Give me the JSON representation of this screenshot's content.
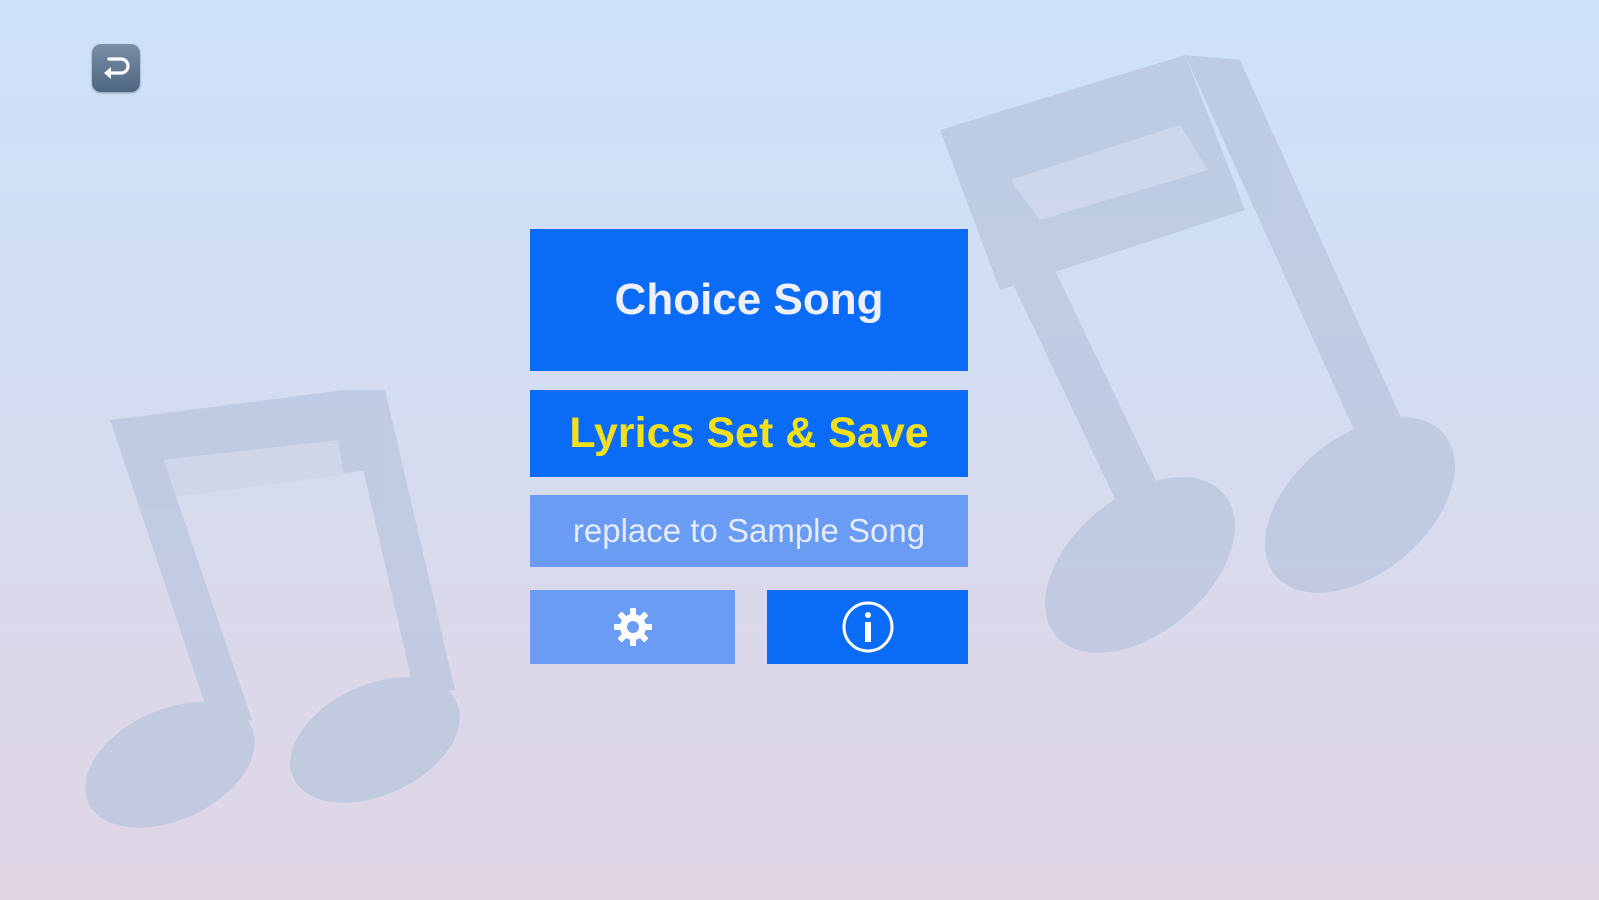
{
  "toolbar": {
    "back_icon": "return-arrow-icon"
  },
  "menu": {
    "choice_song_label": "Choice Song",
    "lyrics_set_save_label": "Lyrics Set & Save",
    "replace_sample_label": "replace to Sample Song",
    "settings_icon": "gear-icon",
    "info_icon": "info-icon"
  },
  "background": {
    "decoration_icon": "music-note-icon"
  },
  "colors": {
    "primary_button": "#0a6cf6",
    "secondary_button": "#6a9cf4",
    "lyrics_text": "#f2e01c",
    "button_text": "#eef0ff"
  }
}
